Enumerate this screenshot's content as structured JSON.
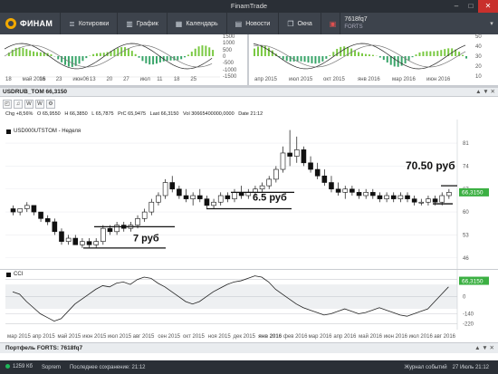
{
  "window": {
    "title": "FinamTrade",
    "min": "–",
    "max": "□",
    "close": "✕"
  },
  "toolbar": {
    "logo": "ФИНАМ",
    "items": [
      {
        "label": "Котировки",
        "icon": "quotes-icon"
      },
      {
        "label": "График",
        "icon": "chart-icon"
      },
      {
        "label": "Календарь",
        "icon": "calendar-icon"
      },
      {
        "label": "Новости",
        "icon": "news-icon"
      },
      {
        "label": "Окна",
        "icon": "windows-icon"
      }
    ],
    "account": "7618fq7",
    "account_sub": "FORTS"
  },
  "top_left": {
    "yticks": [
      "1500",
      "1000",
      "500",
      "0",
      "-500",
      "-1000",
      "-1500"
    ],
    "xticks": [
      "18",
      "май 2016",
      "16",
      "23",
      "июн06",
      "13",
      "20",
      "27",
      "июл",
      "11",
      "18",
      "25"
    ]
  },
  "top_right": {
    "yticks": [
      "50",
      "40",
      "30",
      "20",
      "10"
    ],
    "xticks": [
      "апр 2015",
      "июл 2015",
      "окт 2015",
      "янв 2016",
      "мар 2016",
      "июн 2016"
    ]
  },
  "chart": {
    "header": "USDRUB_TOM 66,3150",
    "header_btns": "▲ ▼ ✕",
    "tools": [
      "◰",
      "♫",
      "W",
      "W",
      "⚙"
    ],
    "info": {
      "chg": "Chg +8,56%",
      "o": "O 65,9550",
      "h": "H 66,3850",
      "l": "L 65,7875",
      "prc": "PrC 65,9475",
      "last": "Last 66,3150",
      "vol": "Vol 30665400000,0000",
      "date": "Date 21:12"
    },
    "legend": "USD000UTSTOM - Неделя",
    "last_price_badge": "66,3150",
    "accent": "#3cb043",
    "annotations": [
      "70.50 руб",
      "6.5 руб",
      "7 руб"
    ],
    "indicator_label": "CCI",
    "indicator_badge": "66,3150"
  },
  "chart_data": {
    "type": "candlestick",
    "title": "USD000UTSTOM - Неделя",
    "yticks": [
      46,
      53,
      60,
      67,
      74,
      81
    ],
    "ylim": [
      44,
      86
    ],
    "xticks": [
      "мар 2015",
      "апр 2015",
      "май 2015",
      "июн 2015",
      "июл 2015",
      "авг 2015",
      "сен 2015",
      "окт 2015",
      "ноя 2015",
      "дек 2015",
      "янв 2016",
      "фев 2016",
      "мар 2016",
      "апр 2016",
      "май 2016",
      "июн 2016",
      "июл 2016",
      "авг 2016"
    ],
    "candles": [
      [
        61,
        62,
        59,
        60
      ],
      [
        60,
        61,
        59,
        61
      ],
      [
        61,
        63,
        60,
        62
      ],
      [
        62,
        62,
        59,
        60
      ],
      [
        60,
        60,
        57,
        58
      ],
      [
        58,
        59,
        56,
        57
      ],
      [
        57,
        58,
        53,
        54
      ],
      [
        54,
        55,
        50,
        51
      ],
      [
        51,
        53,
        50,
        52
      ],
      [
        52,
        53,
        50,
        50
      ],
      [
        50,
        52,
        49,
        51
      ],
      [
        51,
        52,
        49,
        50
      ],
      [
        50,
        52,
        49,
        51
      ],
      [
        51,
        56,
        50,
        55
      ],
      [
        55,
        56,
        53,
        54
      ],
      [
        54,
        57,
        53,
        56
      ],
      [
        56,
        57,
        54,
        55
      ],
      [
        55,
        57,
        54,
        56
      ],
      [
        56,
        59,
        55,
        58
      ],
      [
        58,
        61,
        57,
        60
      ],
      [
        60,
        64,
        59,
        63
      ],
      [
        63,
        66,
        62,
        65
      ],
      [
        65,
        70,
        64,
        69
      ],
      [
        69,
        71,
        66,
        67
      ],
      [
        67,
        68,
        64,
        65
      ],
      [
        65,
        67,
        63,
        64
      ],
      [
        64,
        66,
        62,
        65
      ],
      [
        65,
        67,
        63,
        64
      ],
      [
        64,
        65,
        61,
        62
      ],
      [
        62,
        64,
        61,
        63
      ],
      [
        63,
        66,
        62,
        65
      ],
      [
        65,
        66,
        63,
        64
      ],
      [
        64,
        67,
        63,
        66
      ],
      [
        66,
        68,
        64,
        65
      ],
      [
        65,
        67,
        64,
        66
      ],
      [
        66,
        68,
        65,
        67
      ],
      [
        67,
        69,
        66,
        68
      ],
      [
        68,
        71,
        67,
        70
      ],
      [
        70,
        74,
        69,
        73
      ],
      [
        73,
        80,
        72,
        78
      ],
      [
        78,
        85,
        74,
        77
      ],
      [
        77,
        83,
        75,
        79
      ],
      [
        79,
        80,
        74,
        75
      ],
      [
        75,
        77,
        72,
        73
      ],
      [
        73,
        75,
        70,
        71
      ],
      [
        71,
        73,
        68,
        69
      ],
      [
        69,
        71,
        66,
        67
      ],
      [
        67,
        69,
        65,
        66
      ],
      [
        66,
        68,
        64,
        67
      ],
      [
        67,
        68,
        65,
        66
      ],
      [
        66,
        67,
        64,
        65
      ],
      [
        65,
        67,
        64,
        66
      ],
      [
        66,
        67,
        64,
        65
      ],
      [
        65,
        66,
        63,
        64
      ],
      [
        64,
        66,
        63,
        65
      ],
      [
        65,
        66,
        63,
        64
      ],
      [
        64,
        66,
        63,
        65
      ],
      [
        65,
        66,
        63,
        64
      ],
      [
        64,
        65,
        62,
        63
      ],
      [
        63,
        64,
        62,
        63
      ],
      [
        63,
        65,
        62,
        64
      ],
      [
        64,
        65,
        62,
        63
      ],
      [
        63,
        66,
        62,
        65
      ],
      [
        65,
        67,
        64,
        66
      ]
    ],
    "indicator": {
      "name": "CCI",
      "yticks": [
        140,
        0,
        -140,
        -220
      ],
      "values": [
        40,
        20,
        -40,
        -90,
        -140,
        -170,
        -200,
        -180,
        -120,
        -60,
        -20,
        20,
        60,
        90,
        80,
        110,
        120,
        100,
        140,
        160,
        150,
        110,
        80,
        40,
        0,
        -40,
        -60,
        -40,
        0,
        40,
        70,
        100,
        120,
        130,
        150,
        170,
        160,
        120,
        60,
        20,
        -20,
        -60,
        -90,
        -110,
        -130,
        -150,
        -140,
        -120,
        -100,
        -120,
        -140,
        -130,
        -110,
        -90,
        -110,
        -130,
        -150,
        -160,
        -140,
        -120,
        -100,
        -40,
        20,
        80
      ]
    }
  },
  "portfolio": {
    "title": "Портфель FORTS: 7618fq7",
    "btns": "▲ ▼ ✕"
  },
  "status": {
    "conn": "1259 Кб",
    "server": "Soprem",
    "saved": "Последнее сохранение: 21:12",
    "journal": "Журнал событий",
    "datetime": "27 Июль 21:12"
  }
}
